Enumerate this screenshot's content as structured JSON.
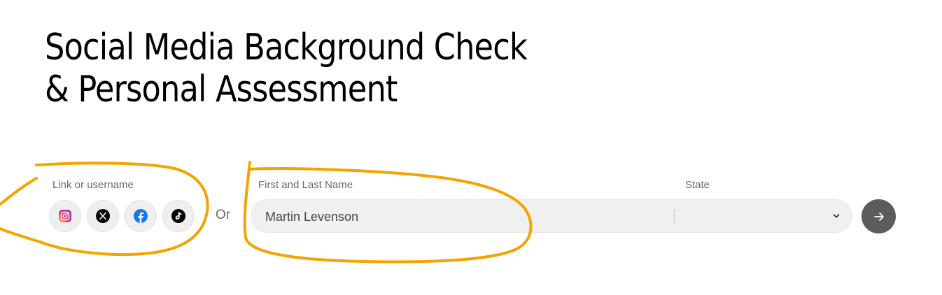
{
  "headline": {
    "line1": "Social Media Background Check",
    "line2": "& Personal Assessment"
  },
  "social": {
    "label": "Link or username",
    "buttons": [
      {
        "icon": "instagram-icon"
      },
      {
        "icon": "x-icon"
      },
      {
        "icon": "facebook-icon"
      },
      {
        "icon": "tiktok-icon"
      }
    ]
  },
  "separator": "Or",
  "form": {
    "name_label": "First and Last Name",
    "name_value": "Martin Levenson",
    "state_label": "State",
    "state_value": ""
  },
  "submit": {
    "icon": "arrow-right-icon"
  },
  "colors": {
    "annotation": "#F5A300",
    "submit_bg": "#5C5C5C",
    "facebook": "#1877F2",
    "input_bg": "#F0F0F0"
  }
}
